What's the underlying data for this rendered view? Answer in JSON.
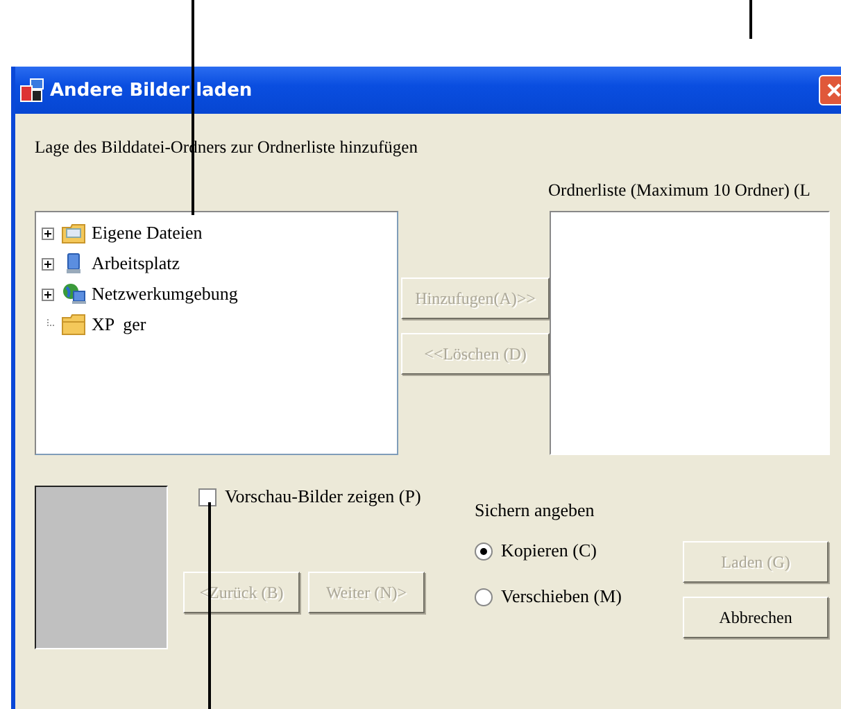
{
  "window": {
    "title": "Andere Bilder laden"
  },
  "instruction": "Lage des Bilddatei-Ordners zur Ordnerliste hinzufügen",
  "folder_list_caption": "Ordnerliste (Maximum 10 Ordner) (L",
  "tree": [
    {
      "label": "Eigene Dateien",
      "kind": "documents",
      "has_children": true
    },
    {
      "label": "Arbeitsplatz",
      "kind": "computer",
      "has_children": true
    },
    {
      "label": "Netzwerkumgebung",
      "kind": "network",
      "has_children": true
    },
    {
      "label": "XP  ger",
      "kind": "folder",
      "has_children": false
    }
  ],
  "transfer_buttons": [
    {
      "label": "Hinzufugen(A)>>",
      "disabled": true
    },
    {
      "label": "<<Löschen (D)",
      "disabled": true
    }
  ],
  "preview_checkbox": {
    "label": "Vorschau-Bilder zeigen (P)",
    "checked": false
  },
  "nav_buttons": [
    {
      "label": "<Zurück (B)",
      "disabled": true
    },
    {
      "label": "Weiter (N)>",
      "disabled": true
    }
  ],
  "save_group": {
    "title": "Sichern angeben",
    "options": [
      {
        "label": "Kopieren (C)",
        "selected": true
      },
      {
        "label": "Verschieben (M)",
        "selected": false
      }
    ]
  },
  "action_buttons": [
    {
      "label": "Laden (G)",
      "disabled": true
    },
    {
      "label": "Abbrechen",
      "disabled": false
    }
  ]
}
